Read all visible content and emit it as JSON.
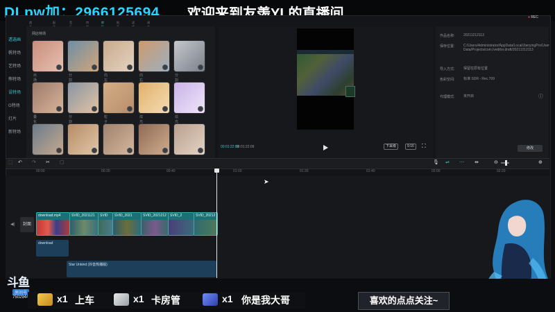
{
  "overlay": {
    "contact": "DLpw加：2966125694",
    "welcome": "欢迎来到友羡YL的直播间",
    "rec": "REC"
  },
  "nav": {
    "items": [
      "透选画",
      "帆特场",
      "艺特场",
      "熊特场",
      "设特场",
      "G特场",
      "灯片",
      "新特场"
    ]
  },
  "category_tabs": [
    "透选",
    "配选",
    "音乐",
    "特效",
    "转场",
    "贴纸",
    "滤镜",
    "调节"
  ],
  "media": {
    "title": "网店特场",
    "thumbs": [
      {
        "label": "出场",
        "colors": [
          "#c98d7c",
          "#e7c0b0"
        ]
      },
      {
        "label": "分割",
        "colors": [
          "#6d8fa6",
          "#d3a57c"
        ]
      },
      {
        "label": "向左拉伸",
        "colors": [
          "#c8a98b",
          "#e4d4c2"
        ]
      },
      {
        "label": "向右拉伸",
        "colors": [
          "#cc9a6b",
          "#9fb0c2"
        ]
      },
      {
        "label": "分割",
        "colors": [
          "#c4c7cc",
          "#7b808a"
        ]
      },
      {
        "label": "叠化 III",
        "colors": [
          "#9d7a6a",
          "#d9b59a"
        ]
      },
      {
        "label": "分割",
        "colors": [
          "#8a95a3",
          "#e2c3a3"
        ]
      },
      {
        "label": "粒子",
        "colors": [
          "#d3ad86",
          "#b88e6a"
        ]
      },
      {
        "label": "炫光 II",
        "colors": [
          "#e2b06c",
          "#f4dcb2"
        ]
      },
      {
        "label": "炫光 III",
        "colors": [
          "#c9b4e8",
          "#efe4f9"
        ]
      },
      {
        "label": "",
        "colors": [
          "#6a7b8c",
          "#c7a98e"
        ]
      },
      {
        "label": "",
        "colors": [
          "#b78c66",
          "#e0c7a8"
        ]
      },
      {
        "label": "",
        "colors": [
          "#a0826e",
          "#d4b79c"
        ]
      },
      {
        "label": "",
        "colors": [
          "#8f6b56",
          "#cfab8d"
        ]
      },
      {
        "label": "",
        "colors": [
          "#b9a08f",
          "#e3d3c5"
        ]
      }
    ]
  },
  "preview": {
    "time_current": "00:01:22:09",
    "time_total": "00:01:22:09",
    "ratio_btn": "9:16",
    "fit_btn": "下采级"
  },
  "properties": {
    "rows": [
      {
        "k": "作品名称:",
        "v": "20211212113"
      },
      {
        "k": "保存位置:",
        "v": "C:/Users/Administrator/AppData/Local/JianyingPro/User Data/Projects/com.lveditor.draft/20211212113"
      },
      {
        "k": "导入方式:",
        "v": "保留在原有位置"
      },
      {
        "k": "色彩空间:",
        "v": "标准 SDR - Rec.709"
      },
      {
        "k": "代理模式:",
        "v": "未开启"
      }
    ],
    "modify_btn": "修改"
  },
  "toolbar": {
    "icons": [
      "undo-icon",
      "redo-icon",
      "split-icon",
      "delete-icon"
    ],
    "right_icons": [
      "mic-icon",
      "link-icon",
      "snap-icon",
      "preview-axis-icon",
      "zoom-out-icon",
      "zoom-in-icon",
      "settings-icon"
    ]
  },
  "ruler": [
    "00:00",
    "00:20",
    "00:40",
    "01:00",
    "01:20",
    "01:40",
    "02:00",
    "02:20"
  ],
  "timeline": {
    "cover_label": "封面",
    "clips": [
      {
        "name": "download.mp4"
      },
      {
        "name": "SVID_2021121"
      },
      {
        "name": "SVID"
      },
      {
        "name": "SVID_2021"
      },
      {
        "name": "SVID_2021212"
      },
      {
        "name": "SVID_2"
      },
      {
        "name": "SVID_20212"
      }
    ],
    "audio_1": "download",
    "audio_2": "Star Unkind (抖音热播版)"
  },
  "stream": {
    "logo": "斗鱼",
    "room_label": "房间号",
    "room_id": "7502944",
    "gifts": [
      {
        "count": "x1",
        "text": "上车",
        "color": "#f2c94c"
      },
      {
        "count": "x1",
        "text": "卡房管",
        "color": "#e8e8e8"
      },
      {
        "count": "x1",
        "text": "你是我大哥",
        "color": "#6f8cff"
      }
    ],
    "follow": "喜欢的点点关注~"
  }
}
